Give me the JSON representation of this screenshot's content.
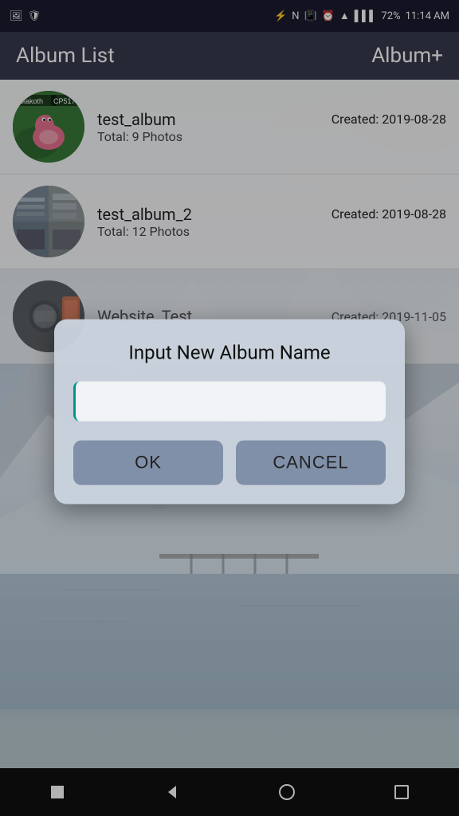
{
  "status_bar": {
    "time": "11:14 AM",
    "battery": "72%",
    "icons_left": [
      "photo-icon",
      "shield-icon"
    ],
    "icons_right": [
      "bluetooth-icon",
      "nfc-icon",
      "vibrate-icon",
      "alarm-icon",
      "wifi-icon",
      "signal-icon",
      "battery-icon"
    ]
  },
  "app_bar": {
    "title": "Album List",
    "action": "Album+"
  },
  "albums": [
    {
      "name": "test_album",
      "created": "Created: 2019-08-28",
      "total": "Total: 9 Photos",
      "thumbnail_type": "pokemon"
    },
    {
      "name": "test_album_2",
      "created": "Created: 2019-08-28",
      "total": "Total: 12 Photos",
      "thumbnail_type": "shelf"
    },
    {
      "name": "Website_Test",
      "created": "Created: 2019-11-05",
      "total": "",
      "thumbnail_type": "dark"
    }
  ],
  "dialog": {
    "title": "Input New Album Name",
    "input_placeholder": "",
    "ok_label": "OK",
    "cancel_label": "CANCEL"
  },
  "bottom_nav": {
    "back_icon": "◁",
    "home_icon": "○",
    "recent_icon": "□",
    "square_icon": "■"
  }
}
